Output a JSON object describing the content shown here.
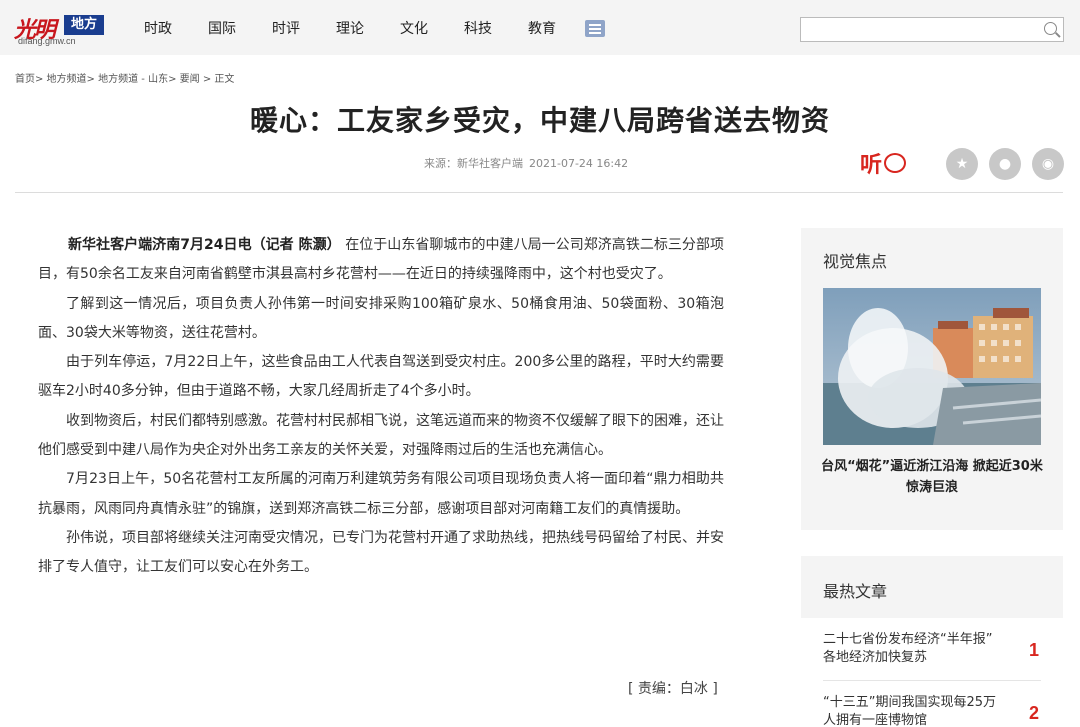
{
  "header": {
    "logo_text": "光明",
    "logo_badge": "地方",
    "logo_domain": "difang.gmw.cn",
    "nav": [
      "时政",
      "国际",
      "时评",
      "理论",
      "文化",
      "科技",
      "教育"
    ],
    "search_placeholder": ""
  },
  "breadcrumb": "首页> 地方频道> 地方频道 - 山东> 要闻 > 正文",
  "article": {
    "title": "暖心：工友家乡受灾，中建八局跨省送去物资",
    "source": "来源：新华社客户端",
    "datetime": "2021-07-24 16:42",
    "listen_label": "听",
    "lead": "新华社客户端济南7月24日电（记者 陈灏）",
    "paragraphs": [
      "在位于山东省聊城市的中建八局一公司郑济高铁二标三分部项目，有50余名工友来自河南省鹤壁市淇县高村乡花营村——在近日的持续强降雨中，这个村也受灾了。",
      "了解到这一情况后，项目负责人孙伟第一时间安排采购100箱矿泉水、50桶食用油、50袋面粉、30箱泡面、30袋大米等物资，送往花营村。",
      "由于列车停运，7月22日上午，这些食品由工人代表自驾送到受灾村庄。200多公里的路程，平时大约需要驱车2小时40多分钟，但由于道路不畅，大家几经周折走了4个多小时。",
      "收到物资后，村民们都特别感激。花营村村民郝相飞说，这笔远道而来的物资不仅缓解了眼下的困难，还让他们感受到中建八局作为央企对外出务工亲友的关怀关爱，对强降雨过后的生活也充满信心。",
      "7月23日上午，50名花营村工友所属的河南万利建筑劳务有限公司项目现场负责人将一面印着“鼎力相助共抗暴雨，风雨同舟真情永驻”的锦旗，送到郑济高铁二标三分部，感谢项目部对河南籍工友们的真情援助。",
      "孙伟说，项目部将继续关注河南受灾情况，已专门为花营村开通了求助热线，把热线号码留给了村民、并安排了专人值守，让工友们可以安心在外务工。"
    ],
    "editor": "[ 责编：白冰 ]"
  },
  "sidebar": {
    "visual_heading": "视觉焦点",
    "photo_caption": "台风“烟花”逼近浙江沿海 掀起近30米惊涛巨浪",
    "hot_heading": "最热文章",
    "hot_items": [
      {
        "text": "二十七省份发布经济“半年报” 各地经济加快复苏",
        "rank": "1"
      },
      {
        "text": "“十三五”期间我国实现每25万人拥有一座博物馆",
        "rank": "2"
      }
    ]
  },
  "colors": {
    "accent_red": "#d8261f",
    "brand_blue": "#1a3d8f",
    "share_gray": "#c8c8c8"
  }
}
